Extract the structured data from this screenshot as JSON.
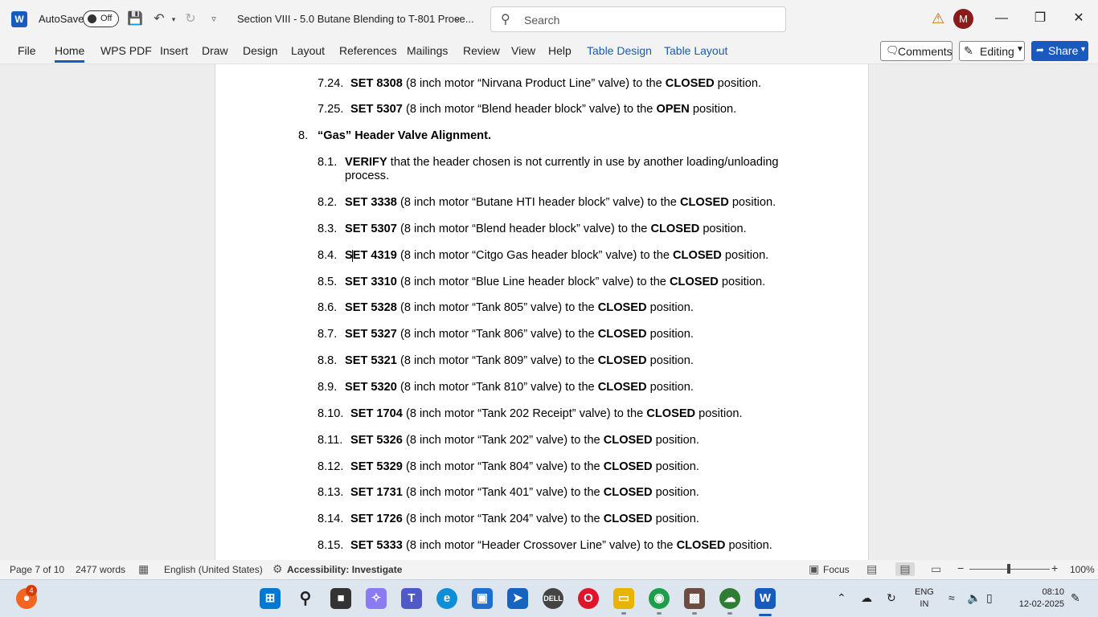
{
  "titlebar": {
    "autosave_label": "AutoSave",
    "autosave_state": "Off",
    "doc_title": "Section VIII - 5.0 Butane Blending to T-801 Proce...",
    "search_placeholder": "Search",
    "avatar_initial": "M"
  },
  "ribbon": {
    "tabs": [
      "File",
      "Home",
      "WPS PDF",
      "Insert",
      "Draw",
      "Design",
      "Layout",
      "References",
      "Mailings",
      "Review",
      "View",
      "Help",
      "Table Design",
      "Table Layout"
    ],
    "active_tab": "Home",
    "comments_label": "Comments",
    "editing_label": "Editing",
    "share_label": "Share",
    "accent_color": "#185abd"
  },
  "document": {
    "prev_items": [
      {
        "num": "7.24.",
        "action": "SET 8308",
        "middle": " (8 inch motor “Nirvana Product Line” valve) to the ",
        "state": "CLOSED",
        "tail": " position."
      },
      {
        "num": "7.25.",
        "action": "SET 5307",
        "middle": " (8 inch motor “Blend header block” valve) to the ",
        "state": "OPEN",
        "tail": " position."
      }
    ],
    "section": {
      "num": "8.",
      "title": "“Gas” Header Valve Alignment."
    },
    "verify": {
      "num": "8.1.",
      "action": "VERIFY",
      "line1": " that the header chosen is not currently in use by another loading/unloading",
      "line2": "process."
    },
    "items": [
      {
        "num": "8.2.",
        "action": "SET 3338",
        "middle": " (8 inch motor “Butane HTI header block” valve) to the ",
        "state": "CLOSED",
        "tail": " position."
      },
      {
        "num": "8.3.",
        "action": "SET 5307",
        "middle": " (8 inch motor “Blend header block” valve) to the ",
        "state": "CLOSED",
        "tail": " position."
      },
      {
        "num": "8.4.",
        "action": "SET 4319",
        "middle": " (8 inch motor “Citgo Gas header block” valve) to the ",
        "state": "CLOSED",
        "tail": " position."
      },
      {
        "num": "8.5.",
        "action": "SET 3310",
        "middle": " (8 inch motor “Blue Line header block” valve) to the ",
        "state": "CLOSED",
        "tail": " position."
      },
      {
        "num": "8.6.",
        "action": "SET 5328",
        "middle": " (8 inch motor “Tank 805” valve) to the ",
        "state": "CLOSED",
        "tail": " position."
      },
      {
        "num": "8.7.",
        "action": "SET 5327",
        "middle": " (8 inch motor “Tank 806” valve) to the ",
        "state": "CLOSED",
        "tail": " position."
      },
      {
        "num": "8.8.",
        "action": "SET 5321",
        "middle": " (8 inch motor “Tank 809” valve) to the ",
        "state": "CLOSED",
        "tail": " position."
      },
      {
        "num": "8.9.",
        "action": "SET 5320",
        "middle": " (8 inch motor “Tank 810” valve) to the ",
        "state": "CLOSED",
        "tail": " position."
      },
      {
        "num": "8.10.",
        "action": "SET 1704",
        "middle": " (8 inch motor “Tank 202 Receipt” valve) to the ",
        "state": "CLOSED",
        "tail": " position."
      },
      {
        "num": "8.11.",
        "action": "SET 5326",
        "middle": " (8 inch motor “Tank 202” valve) to the ",
        "state": "CLOSED",
        "tail": " position."
      },
      {
        "num": "8.12.",
        "action": "SET 5329",
        "middle": " (8 inch motor “Tank 804” valve) to the ",
        "state": "CLOSED",
        "tail": " position."
      },
      {
        "num": "8.13.",
        "action": "SET 1731",
        "middle": " (8 inch motor “Tank 401” valve) to the ",
        "state": "CLOSED",
        "tail": " position."
      },
      {
        "num": "8.14.",
        "action": "SET 1726",
        "middle": " (8 inch motor “Tank 204” valve) to the ",
        "state": "CLOSED",
        "tail": " position."
      },
      {
        "num": "8.15.",
        "action": "SET 5333",
        "middle": " (8 inch motor “Header Crossover Line” valve) to the ",
        "state": "CLOSED",
        "tail": " position."
      }
    ]
  },
  "statusbar": {
    "page": "Page 7 of 10",
    "words": "2477 words",
    "language": "English (United States)",
    "accessibility": "Accessibility: Investigate",
    "focus": "Focus",
    "zoom": "100%"
  },
  "taskbar": {
    "notification_count": "4",
    "lang_line1": "ENG",
    "lang_line2": "IN",
    "time": "08:10",
    "date": "12-02-2025"
  }
}
